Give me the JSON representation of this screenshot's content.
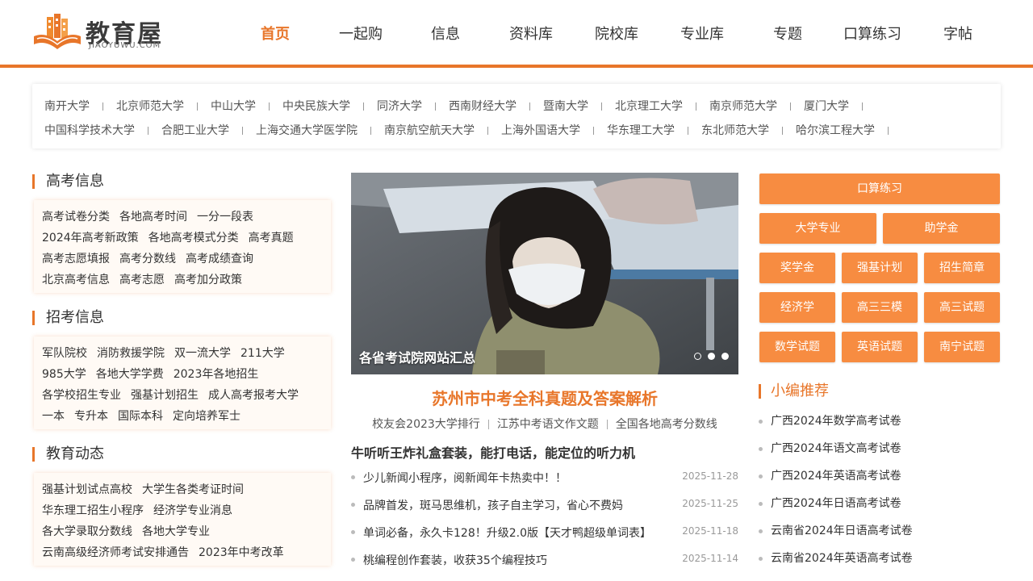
{
  "logo": {
    "text": "教育屋",
    "sub": "JIAOYUWU.COM"
  },
  "nav": [
    {
      "label": "首页",
      "active": true
    },
    {
      "label": "一起购"
    },
    {
      "label": "信息"
    },
    {
      "label": "资料库"
    },
    {
      "label": "院校库"
    },
    {
      "label": "专业库"
    },
    {
      "label": "专题"
    },
    {
      "label": "口算练习"
    },
    {
      "label": "字帖"
    }
  ],
  "universities": {
    "row1": [
      "南开大学",
      "北京师范大学",
      "中山大学",
      "中央民族大学",
      "同济大学",
      "西南财经大学",
      "暨南大学",
      "北京理工大学",
      "南京师范大学",
      "厦门大学"
    ],
    "row2": [
      "中国科学技术大学",
      "合肥工业大学",
      "上海交通大学医学院",
      "南京航空航天大学",
      "上海外国语大学",
      "华东理工大学",
      "东北师范大学",
      "哈尔滨工程大学"
    ]
  },
  "sections": [
    {
      "title": "高考信息",
      "lines": [
        [
          "高考试卷分类",
          "各地高考时间",
          "一分一段表"
        ],
        [
          "2024年高考新政策",
          "各地高考模式分类",
          "高考真题"
        ],
        [
          "高考志愿填报",
          "高考分数线",
          "高考成绩查询"
        ],
        [
          "北京高考信息",
          "高考志愿",
          "高考加分政策"
        ]
      ]
    },
    {
      "title": "招考信息",
      "lines": [
        [
          "军队院校",
          "消防救援学院",
          "双一流大学",
          "211大学"
        ],
        [
          "985大学",
          "各地大学学费",
          "2023年各地招生"
        ],
        [
          "各学校招生专业",
          "强基计划招生",
          "成人高考报考大学"
        ],
        [
          "一本",
          "专升本",
          "国际本科",
          "定向培养军士"
        ]
      ]
    },
    {
      "title": "教育动态",
      "lines": [
        [
          "强基计划试点高校",
          "大学生各类考证时间"
        ],
        [
          "华东理工招生小程序",
          "经济学专业消息"
        ],
        [
          "各大学录取分数线",
          "各地大学专业"
        ],
        [
          "云南高级经济师考试安排通告",
          "2023年中考改革"
        ]
      ]
    }
  ],
  "banner": {
    "caption": "各省考试院网站汇总"
  },
  "headline": "苏州市中考全科真题及答案解析",
  "sublinks": [
    "校友会2023大学排行",
    "江苏中考语文作文题",
    "全国各地高考分数线"
  ],
  "feature": "牛听听王炸礼盒套装，能打电话，能定位的听力机",
  "news": [
    {
      "title": "少儿新闻小程序，阅新闻年卡热卖中！！",
      "date": "2025-11-28"
    },
    {
      "title": "品牌首发，斑马思维机，孩子自主学习，省心不费妈",
      "date": "2025-11-25"
    },
    {
      "title": "单词必备，永久卡128！升级2.0版【天才鸭超级单词表】",
      "date": "2025-11-18"
    },
    {
      "title": "桃编程创作套装，收获35个编程技巧",
      "date": "2025-11-14"
    }
  ],
  "buttons": {
    "wide": "口算练习",
    "row2": [
      "大学专业",
      "助学金"
    ],
    "row3": [
      "奖学金",
      "强基计划",
      "招生简章"
    ],
    "row4": [
      "经济学",
      "高三三模",
      "高三试题"
    ],
    "row5": [
      "数学试题",
      "英语试题",
      "南宁试题"
    ]
  },
  "recommend": {
    "title": "小编推荐",
    "items": [
      "广西2024年数学高考试卷",
      "广西2024年语文高考试卷",
      "广西2024年英语高考试卷",
      "广西2024年日语高考试卷",
      "云南省2024年日语高考试卷",
      "云南省2024年英语高考试卷"
    ]
  },
  "colors": {
    "accent": "#e8762a",
    "button": "#f78c41"
  }
}
